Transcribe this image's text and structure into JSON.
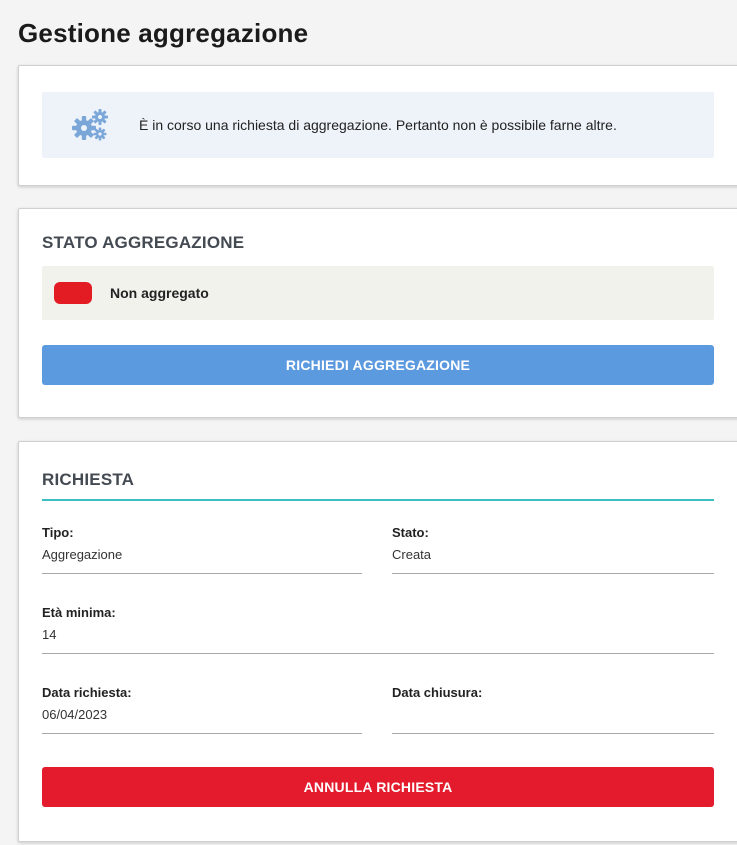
{
  "page": {
    "title": "Gestione aggregazione"
  },
  "info": {
    "icon": "gears-icon",
    "message": "È in corso una richiesta di aggregazione. Pertanto non è possibile farne altre."
  },
  "stato": {
    "title": "STATO AGGREGAZIONE",
    "status_label": "Non aggregato",
    "status_color": "#e31c24",
    "button_label": "RICHIEDI AGGREGAZIONE"
  },
  "richiesta": {
    "title": "RICHIESTA",
    "fields": {
      "tipo": {
        "label": "Tipo:",
        "value": "Aggregazione"
      },
      "stato": {
        "label": "Stato:",
        "value": "Creata"
      },
      "eta_minima": {
        "label": "Età minima:",
        "value": "14"
      },
      "data_richiesta": {
        "label": "Data richiesta:",
        "value": "06/04/2023"
      },
      "data_chiusura": {
        "label": "Data chiusura:",
        "value": ""
      }
    },
    "button_label": "ANNULLA RICHIESTA"
  },
  "colors": {
    "primary": "#5c9ae0",
    "danger": "#e31b2c",
    "accent": "#3bbfc4",
    "info_bg": "#eef3fa"
  }
}
